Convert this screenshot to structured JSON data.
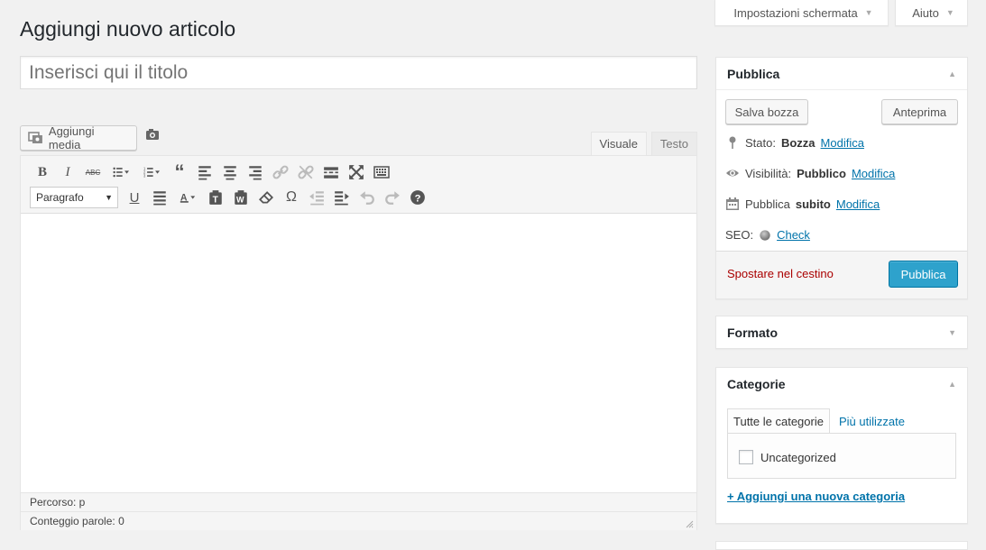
{
  "header": {
    "screen_options": "Impostazioni schermata",
    "help": "Aiuto",
    "page_title": "Aggiungi nuovo articolo"
  },
  "title_field": {
    "placeholder": "Inserisci qui il titolo"
  },
  "media": {
    "add_media": "Aggiungi media"
  },
  "editor": {
    "tabs": [
      "Visuale",
      "Testo"
    ],
    "active_tab": "Visuale",
    "format_select": "Paragrafo",
    "path": "Percorso: p",
    "word_count": "Conteggio parole: 0"
  },
  "publish_box": {
    "title": "Pubblica",
    "save_draft": "Salva bozza",
    "preview": "Anteprima",
    "status_label": "Stato:",
    "status_value": "Bozza",
    "visibility_label": "Visibilità:",
    "visibility_value": "Pubblico",
    "publish_label": "Pubblica",
    "publish_value": "subito",
    "edit_link": "Modifica",
    "seo_label": "SEO:",
    "seo_link": "Check",
    "trash": "Spostare nel cestino",
    "publish_button": "Pubblica"
  },
  "format_box": {
    "title": "Formato"
  },
  "categories_box": {
    "title": "Categorie",
    "tabs": [
      "Tutte le categorie",
      "Più utilizzate"
    ],
    "items": [
      {
        "label": "Uncategorized",
        "checked": false
      }
    ],
    "add_link": "+ Aggiungi una nuova categoria"
  },
  "colors": {
    "primary_button": "#2ea2cc",
    "link": "#0073aa",
    "trash": "#aa0000",
    "background": "#f1f1f1"
  }
}
